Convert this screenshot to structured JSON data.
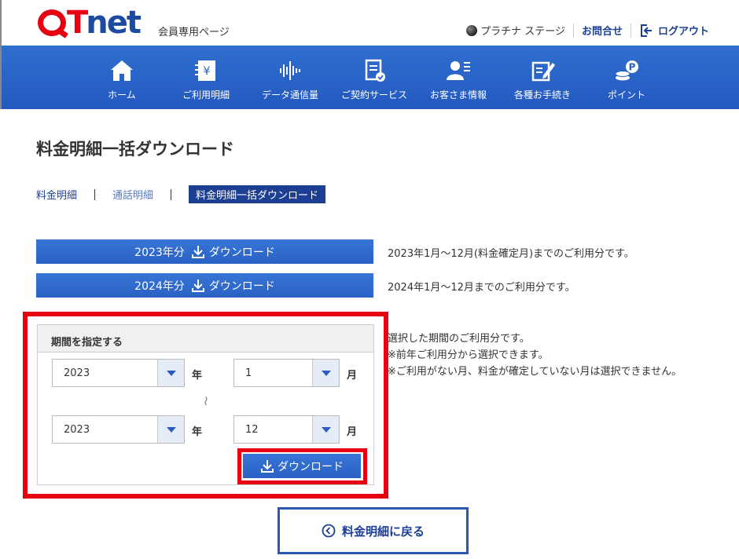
{
  "header": {
    "logo_q": "Q",
    "logo_t": "T",
    "logo_net": "net",
    "member_label": "会員専用ページ",
    "stage": "プラチナ ステージ",
    "contact": "お問合せ",
    "logout": "ログアウト"
  },
  "nav": {
    "items": [
      {
        "label": "ホーム",
        "icon": "home-icon"
      },
      {
        "label": "ご利用明細",
        "icon": "bill-icon"
      },
      {
        "label": "データ通信量",
        "icon": "waveform-icon"
      },
      {
        "label": "ご契約サービス",
        "icon": "contract-icon"
      },
      {
        "label": "お客さま情報",
        "icon": "user-icon"
      },
      {
        "label": "各種お手続き",
        "icon": "edit-icon"
      },
      {
        "label": "ポイント",
        "icon": "points-icon"
      }
    ]
  },
  "page": {
    "title": "料金明細一括ダウンロード",
    "tabs": [
      "料金明細",
      "通話明細",
      "料金明細一括ダウンロード"
    ]
  },
  "downloads": [
    {
      "year_label": "2023年分",
      "button_label": "ダウンロード",
      "description": "2023年1月～12月(料金確定月)までのご利用分です。"
    },
    {
      "year_label": "2024年分",
      "button_label": "ダウンロード",
      "description": "2024年1月～12月までのご利用分です。"
    }
  ],
  "period": {
    "heading": "期間を指定する",
    "start_year": "2023",
    "start_month": "1",
    "end_year": "2023",
    "end_month": "12",
    "year_unit": "年",
    "month_unit": "月",
    "tilde": "～",
    "download_label": "ダウンロード",
    "desc_lines": [
      "選択した期間のご利用分です。",
      "※前年ご利用分から選択できます。",
      "※ご利用がない月、料金が確定していない月は選択できません。"
    ]
  },
  "back_label": "料金明細に戻る",
  "colors": {
    "brand_red": "#e60012",
    "brand_blue": "#1c3f94",
    "nav_blue": "#2a61c4"
  }
}
